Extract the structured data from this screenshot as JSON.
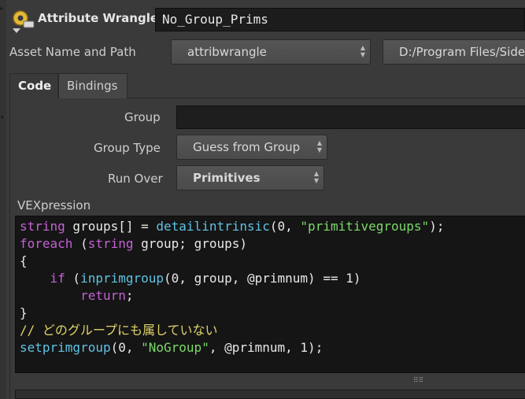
{
  "header": {
    "node_type": "Attribute Wrangle",
    "node_name": "No_Group_Prims"
  },
  "asset": {
    "label": "Asset Name and Path",
    "name_value": "attribwrangle",
    "path_value": "D:/Program Files/Side"
  },
  "tabs": [
    {
      "label": "Code",
      "active": true
    },
    {
      "label": "Bindings",
      "active": false
    }
  ],
  "params": {
    "group_label": "Group",
    "group_value": "",
    "group_type_label": "Group Type",
    "group_type_value": "Guess from Group",
    "run_over_label": "Run Over",
    "run_over_value": "Primitives"
  },
  "vex": {
    "label": "VEXpression",
    "lines": [
      [
        {
          "t": "string",
          "c": "kw"
        },
        {
          "t": " groups[] = ",
          "c": ""
        },
        {
          "t": "detailintrinsic",
          "c": "fn"
        },
        {
          "t": "(0, ",
          "c": ""
        },
        {
          "t": "\"primitivegroups\"",
          "c": "str"
        },
        {
          "t": ");",
          "c": ""
        }
      ],
      [
        {
          "t": "foreach",
          "c": "kw"
        },
        {
          "t": " (",
          "c": ""
        },
        {
          "t": "string",
          "c": "kw"
        },
        {
          "t": " group; groups)",
          "c": ""
        }
      ],
      [
        {
          "t": "{",
          "c": ""
        }
      ],
      [
        {
          "t": "    ",
          "c": ""
        },
        {
          "t": "if",
          "c": "kw"
        },
        {
          "t": " (",
          "c": ""
        },
        {
          "t": "inprimgroup",
          "c": "fn"
        },
        {
          "t": "(0, group, @primnum) == 1)",
          "c": ""
        }
      ],
      [
        {
          "t": "        ",
          "c": ""
        },
        {
          "t": "return",
          "c": "kw"
        },
        {
          "t": ";",
          "c": ""
        }
      ],
      [
        {
          "t": "}",
          "c": ""
        }
      ],
      [
        {
          "t": "// どのグループにも属していない",
          "c": "cm"
        }
      ],
      [
        {
          "t": "setprimgroup",
          "c": "fn"
        },
        {
          "t": "(0, ",
          "c": ""
        },
        {
          "t": "\"NoGroup\"",
          "c": "str"
        },
        {
          "t": ", @primnum, 1);",
          "c": ""
        }
      ]
    ]
  },
  "colors": {
    "keyword": "#c561d6",
    "function": "#5fc3e3",
    "string": "#7bd96a",
    "comment": "#e0d36a",
    "background": "#3a3a3a"
  }
}
